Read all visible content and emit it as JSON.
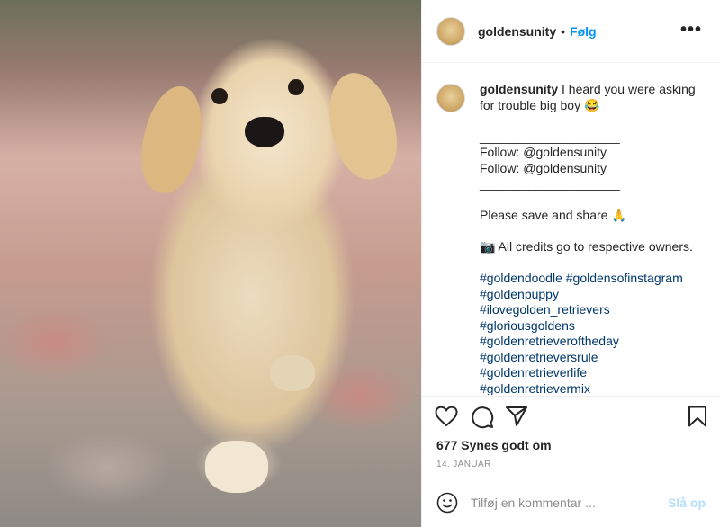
{
  "post": {
    "username": "goldensunity",
    "separator": "•",
    "follow_label": "Følg",
    "more_label": "•••",
    "image_alt_icon": "photo-golden-retriever-puppy"
  },
  "caption": {
    "username": "goldensunity",
    "line1": "I heard you were asking",
    "line2": "for trouble big boy 😂",
    "rule1": "____________________",
    "follow1": "Follow: @goldensunity",
    "follow2": "Follow: @goldensunity",
    "rule2": "____________________",
    "save_share": "Please save and share 🙏",
    "credits": "📷 All credits go to respective owners.",
    "hashtags": [
      "#goldendoodle  #goldensofinstagram",
      " #goldenpuppy",
      "#ilovegolden_retrievers",
      " #gloriousgoldens",
      "#goldenretrieveroftheday",
      " #goldenretrieversrule",
      " #goldenretrieverlife",
      " #goldenretrievermix"
    ]
  },
  "actions": {
    "likes": "677 Synes godt om",
    "date": "14. JANUAR"
  },
  "comment": {
    "placeholder": "Tilføj en kommentar ...",
    "post_label": "Slå op"
  },
  "colors": {
    "link": "#0095f6",
    "hashtag": "#00376b",
    "text": "#262626",
    "muted": "#8e8e8e",
    "post_disabled": "#b2dffc"
  }
}
